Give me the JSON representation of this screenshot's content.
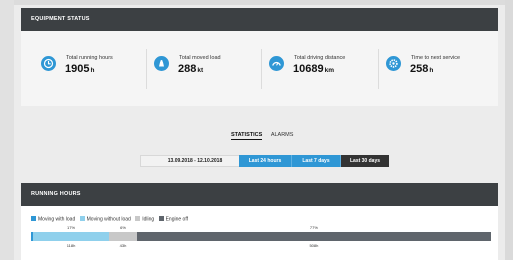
{
  "equipment_status": {
    "title": "EQUIPMENT STATUS",
    "metrics": [
      {
        "label": "Total running hours",
        "value": "1905",
        "unit": "h",
        "icon": "clock-icon"
      },
      {
        "label": "Total moved load",
        "value": "288",
        "unit": "kt",
        "icon": "weight-icon"
      },
      {
        "label": "Total driving distance",
        "value": "10689",
        "unit": "km",
        "icon": "speedometer-icon"
      },
      {
        "label": "Time to next service",
        "value": "258",
        "unit": "h",
        "icon": "gear-icon"
      }
    ]
  },
  "tabs": [
    {
      "label": "STATISTICS",
      "active": true
    },
    {
      "label": "ALARMS",
      "active": false
    }
  ],
  "date_range": "13.09.2018 - 12.10.2018",
  "range_buttons": [
    {
      "label": "Last 24 hours",
      "active": false
    },
    {
      "label": "Last 7 days",
      "active": false
    },
    {
      "label": "Last 30 days",
      "active": true
    }
  ],
  "running_hours": {
    "title": "RUNNING HOURS",
    "legend": [
      {
        "label": "Moving with load",
        "color": "#2f97d5"
      },
      {
        "label": "Moving without load",
        "color": "#8fd0ec"
      },
      {
        "label": "Idling",
        "color": "#c8c8c8"
      },
      {
        "label": "Engine off",
        "color": "#5f656c"
      }
    ],
    "segments": [
      {
        "name": "Moving with load",
        "percent_label": "",
        "hours_label": "",
        "share": 0.004,
        "color": "#2f97d5"
      },
      {
        "name": "Moving without load",
        "percent_label": "17%",
        "hours_label": "118h",
        "share": 0.166,
        "color": "#8fd0ec"
      },
      {
        "name": "Idling",
        "percent_label": "6%",
        "hours_label": "43h",
        "share": 0.06,
        "color": "#c8c8c8"
      },
      {
        "name": "Engine off",
        "percent_label": "77%",
        "hours_label": "508h",
        "share": 0.77,
        "color": "#5f656c"
      }
    ]
  },
  "colors": {
    "accent": "#2f97d5",
    "header": "#3c4043"
  }
}
